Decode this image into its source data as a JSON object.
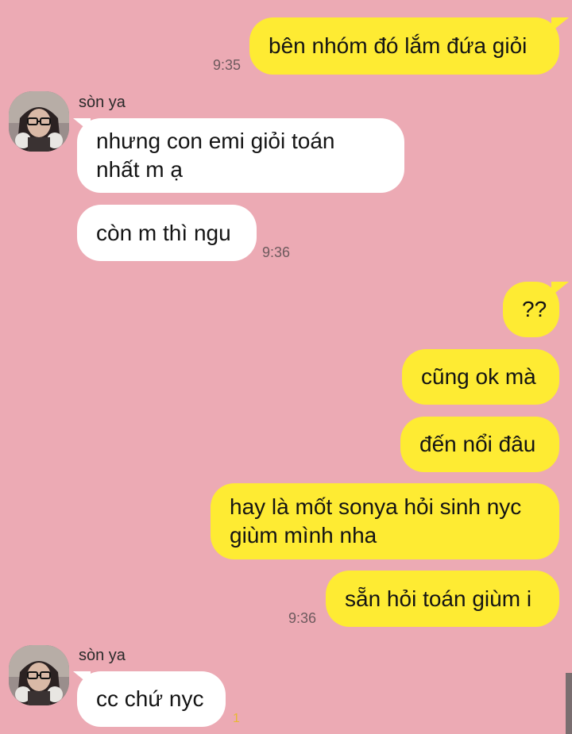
{
  "chat": {
    "contact_name": "sòn ya",
    "messages": [
      {
        "id": "m1",
        "direction": "out",
        "text": "bên nhóm đó lắm đứa giỏi",
        "time": "9:35"
      },
      {
        "id": "m2",
        "direction": "in",
        "lines": [
          "nhưng con emi giỏi toán",
          "nhất m ạ"
        ]
      },
      {
        "id": "m3",
        "direction": "in",
        "text": "còn m thì ngu",
        "time": "9:36"
      },
      {
        "id": "m4",
        "direction": "out",
        "text": "??"
      },
      {
        "id": "m5",
        "direction": "out",
        "text": "cũng ok mà"
      },
      {
        "id": "m6",
        "direction": "out",
        "text": "đến nổi đâu"
      },
      {
        "id": "m7",
        "direction": "out",
        "lines": [
          "hay là mốt sonya hỏi sinh nyc",
          "giùm mình nha"
        ]
      },
      {
        "id": "m8",
        "direction": "out",
        "text": "sẵn hỏi toán giùm i",
        "time": "9:36"
      },
      {
        "id": "m9",
        "direction": "in",
        "text": "cc chứ nyc",
        "unread": "1"
      }
    ]
  },
  "colors": {
    "background": "#ECAAB4",
    "outgoing_bubble": "#FEEB33",
    "incoming_bubble": "#FFFFFF",
    "unread_count": "#E8B934"
  },
  "icons": {
    "avatar": "contact-photo-woman-glasses-headphones"
  }
}
